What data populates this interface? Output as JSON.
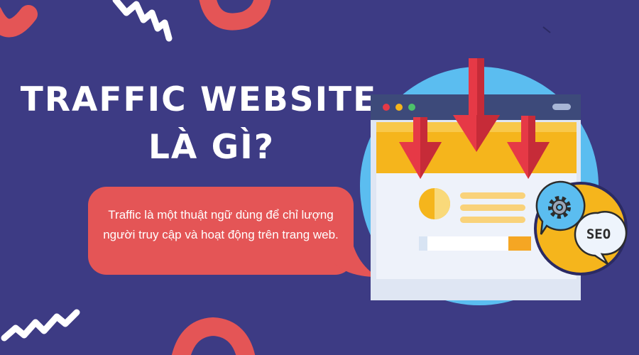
{
  "title": {
    "line1": "TRAFFIC WEBSITE",
    "line2": "LÀ GÌ?"
  },
  "bubble": {
    "text": "Traffic là một thuật ngữ dùng để chỉ lượng người truy cập và hoạt động trên trang web."
  },
  "seo_badge": {
    "label": "SEO"
  },
  "colors": {
    "background": "#3d3b84",
    "accent_red": "#e45556",
    "circle_blue": "#5bbdf0",
    "banner_yellow": "#f5b51c",
    "arrow_red": "#e63946",
    "browser_bar": "#3d4a7a",
    "page_light": "#e9eef8"
  },
  "icons": [
    "gear-icon",
    "down-arrow-icon",
    "speech-bubble-icon",
    "browser-window-icon"
  ]
}
